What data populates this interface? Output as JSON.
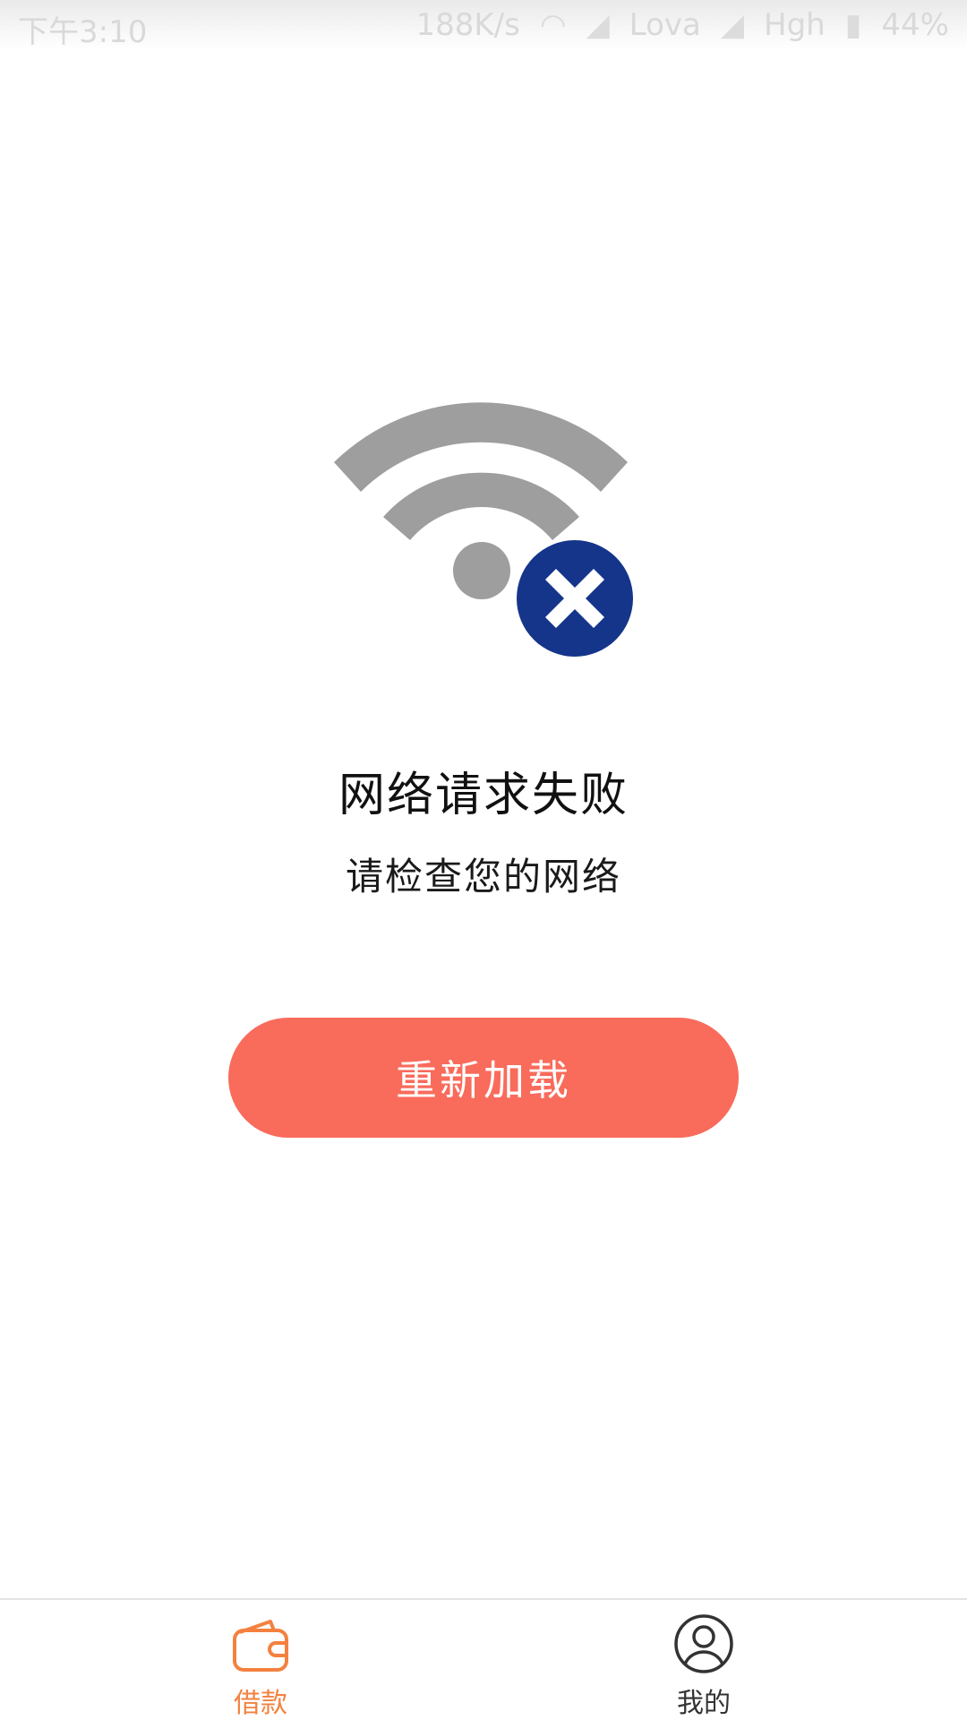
{
  "status_bar": {
    "time": "下午3:10",
    "net_speed": "188K/s",
    "carrier_1": "Lova",
    "carrier_2": "Hgh",
    "battery": "44%"
  },
  "error": {
    "icon": "wifi-off-icon",
    "title": "网络请求失败",
    "subtitle": "请检查您的网络"
  },
  "actions": {
    "reload_label": "重新加载"
  },
  "tab_bar": {
    "tabs": [
      {
        "label": "借款",
        "icon": "wallet-icon",
        "active": true
      },
      {
        "label": "我的",
        "icon": "user-profile-icon",
        "active": false
      }
    ]
  },
  "colors": {
    "accent": "#f96b5b",
    "tab_active": "#f4813f",
    "wifi_gray": "#9e9e9e",
    "error_badge": "#14358a"
  }
}
